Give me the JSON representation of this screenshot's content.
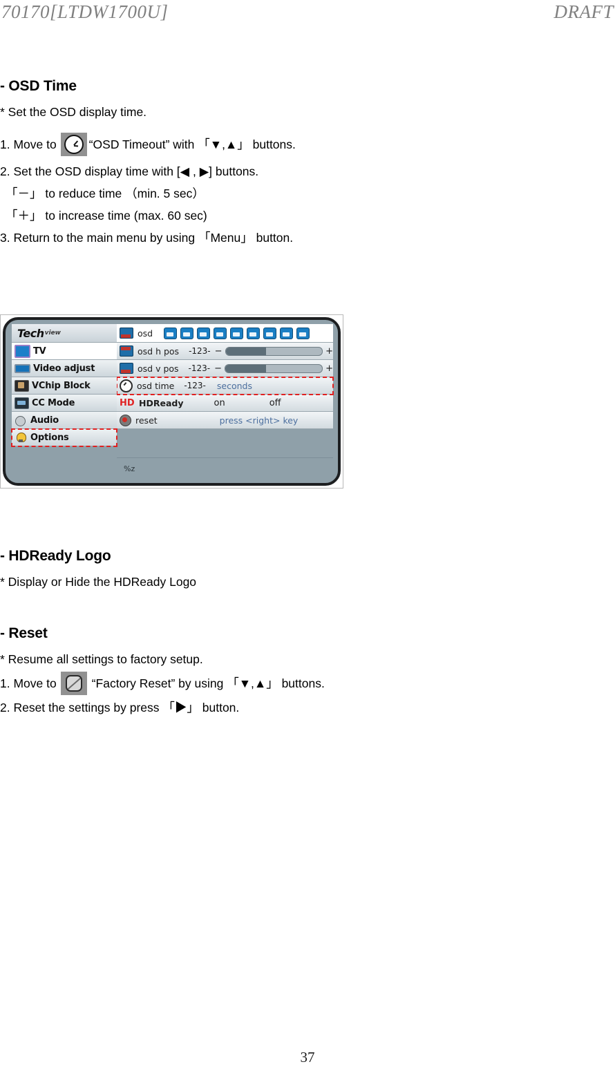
{
  "header": {
    "left": "70170[LTDW1700U]",
    "right": "DRAFT"
  },
  "sections": {
    "osd_time": {
      "title": "- OSD Time",
      "desc": "* Set the OSD display time.",
      "step1_pre": "1. Move to",
      "step1_post": "“OSD Timeout” with 「▼,▲」 buttons.",
      "step2": "2. Set the OSD display time with [◀ , ▶] buttons.",
      "step2a": "「－」 to reduce time （min. 5 sec）",
      "step2b": "「＋」 to increase time (max. 60 sec)",
      "step3": "3. Return to the main menu by using 「Menu」 button."
    },
    "hdready": {
      "title": "- HDReady Logo",
      "desc": "* Display or Hide the HDReady Logo"
    },
    "reset": {
      "title": "- Reset",
      "desc": "* Resume all settings to factory setup.",
      "step1_pre": "1. Move to",
      "step1_post": "“Factory Reset” by using 「▼,▲」 buttons.",
      "step2": "2. Reset the settings by press 「▶」 button."
    }
  },
  "osd_figure": {
    "brand_tech": "Tech",
    "brand_view": "view",
    "sidebar": [
      {
        "label": "TV",
        "icon": "tv-icon",
        "selected": true,
        "highlighted": false
      },
      {
        "label": "Video adjust",
        "icon": "video-adjust-icon",
        "selected": false,
        "highlighted": false
      },
      {
        "label": "VChip Block",
        "icon": "vchip-block-icon",
        "selected": false,
        "highlighted": false
      },
      {
        "label": "CC Mode",
        "icon": "cc-mode-icon",
        "selected": false,
        "highlighted": false
      },
      {
        "label": "Audio",
        "icon": "audio-icon",
        "selected": false,
        "highlighted": false
      },
      {
        "label": "Options",
        "icon": "options-icon",
        "selected": false,
        "highlighted": true
      }
    ],
    "rows": {
      "osd": {
        "label": "osd",
        "lang_count": 9
      },
      "osd_h_pos": {
        "label": "osd h pos",
        "value": "-123-",
        "minus": "−",
        "plus": "+",
        "fill_pct": 42
      },
      "osd_v_pos": {
        "label": "osd v pos",
        "value": "-123-",
        "minus": "−",
        "plus": "+",
        "fill_pct": 42
      },
      "osd_time": {
        "label": "osd time",
        "value": "-123-",
        "unit": "seconds",
        "highlighted": true
      },
      "hdready": {
        "badge": "HD",
        "label": "HDReady",
        "opt_on": "on",
        "opt_off": "off"
      },
      "reset": {
        "label": "reset",
        "hint": "press <right> key"
      }
    },
    "footer_text": "%z",
    "colors": {
      "bezel": "#1d1f21",
      "panel_bg": "#8fa0a9",
      "highlight": "#e02020",
      "accent_blue": "#1b7fc4",
      "hint_blue": "#4c6f9e",
      "hd_red": "#e02424"
    }
  },
  "page_number": "37"
}
